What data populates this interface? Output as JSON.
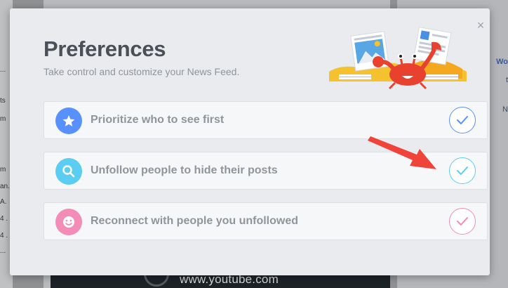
{
  "modal": {
    "title": "Preferences",
    "subtitle": "Take control and customize your News Feed.",
    "close_glyph": "×",
    "options": [
      {
        "label": "Prioritize who to see first",
        "icon": "star-icon",
        "color": "#5890ff"
      },
      {
        "label": "Unfollow people to hide their posts",
        "icon": "search-icon",
        "color": "#5bcdf0"
      },
      {
        "label": "Reconnect with people you unfollowed",
        "icon": "smile-icon",
        "color": "#f38cb6"
      }
    ]
  },
  "background": {
    "video_caption": "www.youtube.com",
    "right_fragments": [
      "Wo",
      "t",
      "N"
    ],
    "left_fragments": [
      "...",
      "ts",
      "m",
      "m",
      "an.",
      "A.",
      "4 .",
      "4 .",
      "..."
    ]
  },
  "colors": {
    "accent_red": "#f0433a",
    "title_gray": "#4b4f56",
    "text_gray": "#90949c"
  }
}
